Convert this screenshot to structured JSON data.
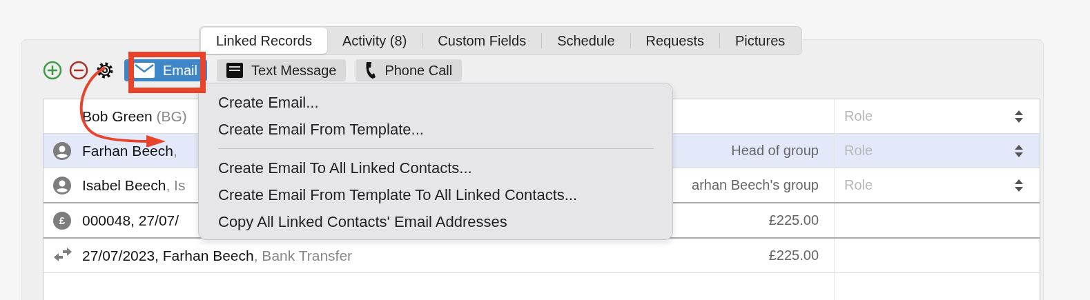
{
  "tabs": [
    {
      "label": "Linked Records",
      "selected": true
    },
    {
      "label": "Activity (8)",
      "selected": false
    },
    {
      "label": "Custom Fields",
      "selected": false
    },
    {
      "label": "Schedule",
      "selected": false
    },
    {
      "label": "Requests",
      "selected": false
    },
    {
      "label": "Pictures",
      "selected": false
    }
  ],
  "toolbar": {
    "buttons": [
      {
        "kind": "email",
        "label": "Email"
      },
      {
        "kind": "text",
        "label": "Text Message"
      },
      {
        "kind": "phone",
        "label": "Phone Call"
      }
    ]
  },
  "table": {
    "rows": [
      {
        "kind": "plain",
        "name": "Bob Green",
        "detail": " (BG)",
        "right": "",
        "role": "Role",
        "selected": false
      },
      {
        "kind": "person",
        "name": "Farhan Beech",
        "detail": ",",
        "right": "Head of group",
        "role": "Role",
        "selected": true
      },
      {
        "kind": "person",
        "name": "Isabel Beech",
        "detail": ", Is",
        "right": "arhan Beech's group",
        "role": "Role",
        "selected": false
      },
      {
        "kind": "payment",
        "icon_text": "£",
        "name": "000048, 27/07/",
        "detail": "",
        "right": "£225.00",
        "selected": false
      },
      {
        "kind": "transfer",
        "name": "27/07/2023, Farhan Beech",
        "detail": ", Bank Transfer",
        "right": "£225.00",
        "selected": false
      }
    ]
  },
  "menu": {
    "items": [
      {
        "kind": "item",
        "label": "Create Email..."
      },
      {
        "kind": "item",
        "label": "Create Email From Template..."
      },
      {
        "kind": "separator"
      },
      {
        "kind": "item",
        "label": "Create Email To All Linked Contacts..."
      },
      {
        "kind": "item",
        "label": "Create Email From Template To All Linked Contacts..."
      },
      {
        "kind": "item",
        "label": "Copy All Linked Contacts' Email Addresses"
      }
    ]
  }
}
